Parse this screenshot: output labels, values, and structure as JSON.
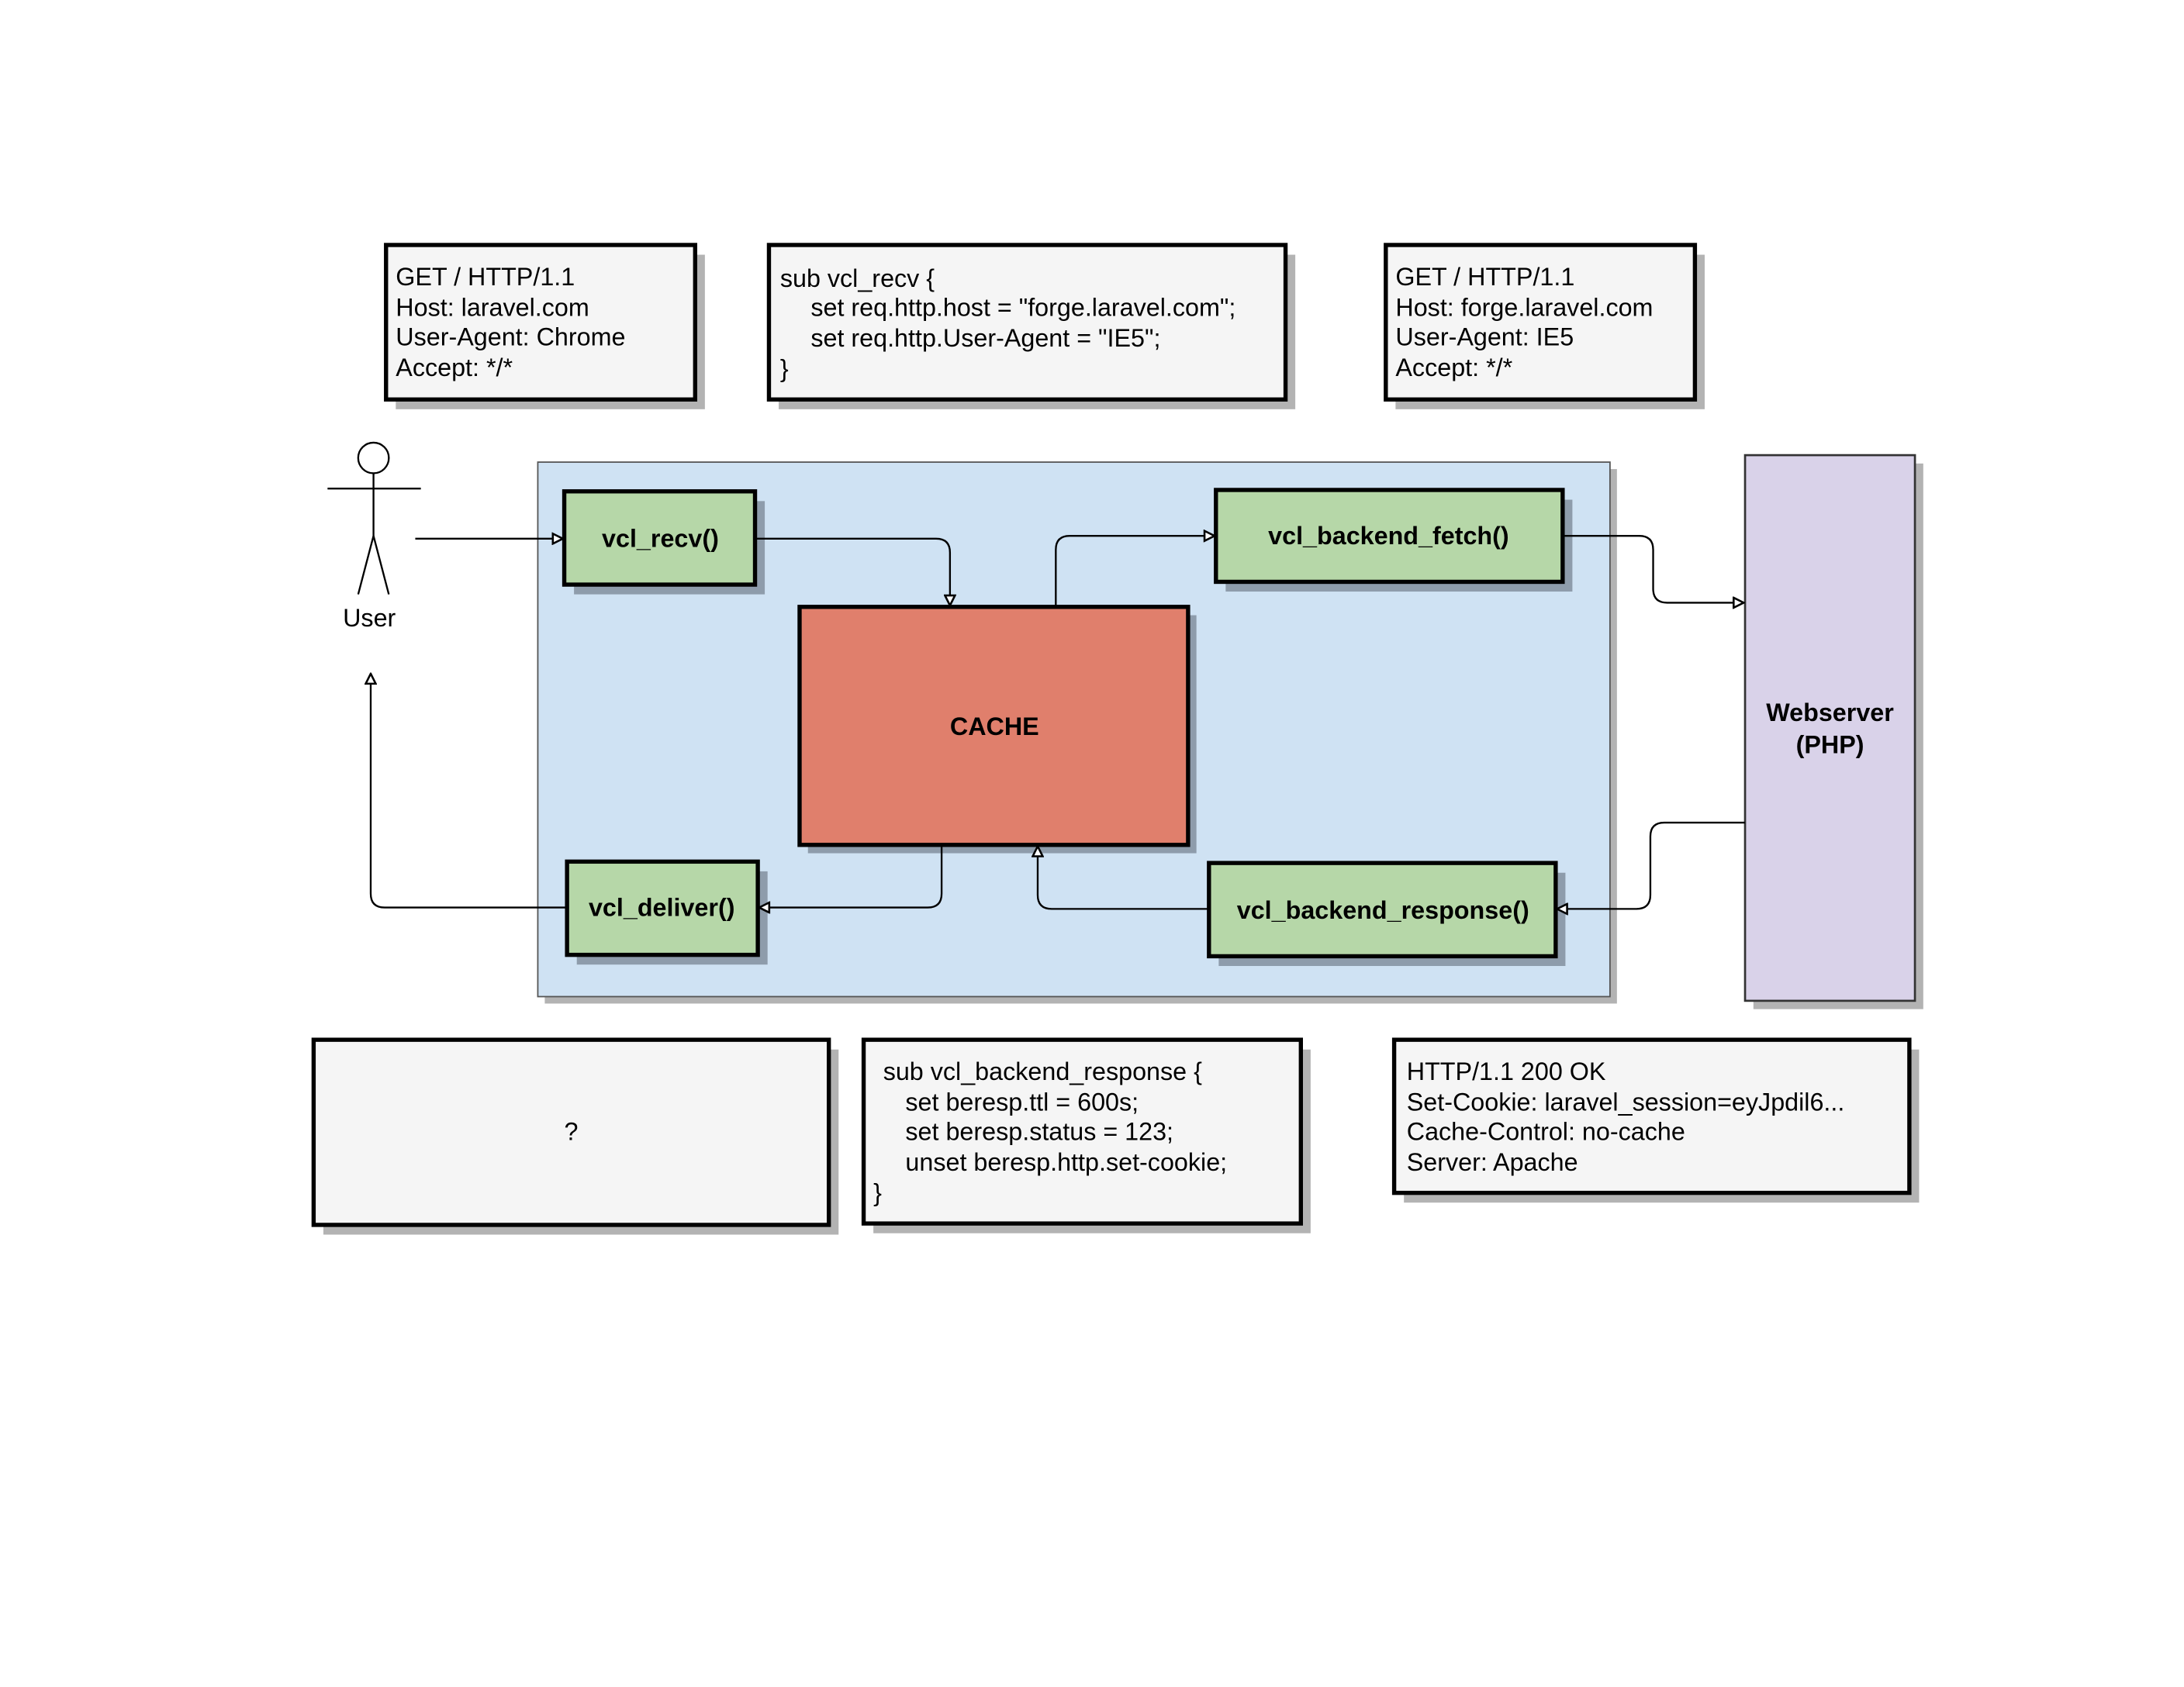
{
  "colors": {
    "container": "#cfe2f3",
    "function_node": "#b6d7a8",
    "cache": "#e07f6c",
    "webserver": "#d9d2e9",
    "note": "#f5f5f5"
  },
  "actor": {
    "label": "User",
    "icon": "stick-figure-icon"
  },
  "nodes": {
    "vcl_recv": "vcl_recv()",
    "vcl_backend_fetch": "vcl_backend_fetch()",
    "cache": "CACHE",
    "vcl_deliver": "vcl_deliver()",
    "vcl_backend_response": "vcl_backend_response()",
    "webserver": [
      "Webserver",
      "(PHP)"
    ]
  },
  "notes": {
    "client_request": [
      "GET / HTTP/1.1",
      "Host: laravel.com",
      "User-Agent: Chrome",
      "Accept: */*"
    ],
    "vcl_recv_code": [
      "sub vcl_recv {",
      "set req.http.host = \"forge.laravel.com\";",
      "set req.http.User-Agent = \"IE5\";",
      "}"
    ],
    "backend_request": [
      "GET / HTTP/1.1",
      "Host: forge.laravel.com",
      "User-Agent: IE5",
      "Accept: */*"
    ],
    "deliver_response": [
      "?"
    ],
    "vcl_backend_response_code": [
      "sub vcl_backend_response {",
      "set beresp.ttl = 600s;",
      "set beresp.status = 123;",
      "unset beresp.http.set-cookie;",
      "}"
    ],
    "backend_response": [
      "HTTP/1.1 200 OK",
      "Set-Cookie: laravel_session=eyJpdil6...",
      "Cache-Control: no-cache",
      "Server: Apache"
    ]
  }
}
